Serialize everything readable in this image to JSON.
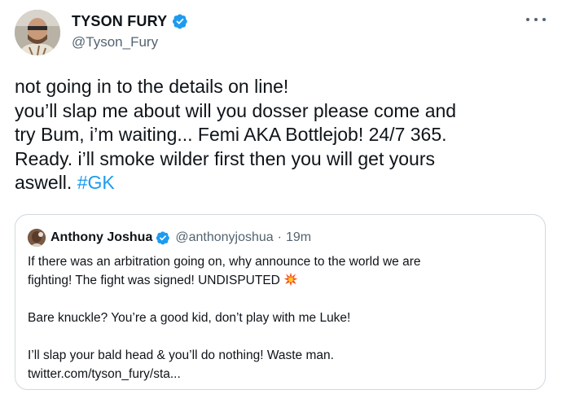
{
  "tweet": {
    "author": {
      "display_name": "TYSON FURY",
      "handle": "@Tyson_Fury",
      "verified_icon": "verified-badge-icon"
    },
    "more_icon": "more-options-icon",
    "text_lines": [
      "not going in to the details on line!",
      "you’ll slap me about will you dosser please come and",
      "try Bum, i’m waiting... Femi AKA Bottlejob! 24/7 365.",
      "Ready. i’ll smoke wilder first then you will get yours"
    ],
    "text_last_prefix": "aswell. ",
    "hashtag": "#GK"
  },
  "quote": {
    "display_name": "Anthony Joshua",
    "handle": "@anthonyjoshua",
    "separator": "·",
    "time": "19m",
    "line1": "If there was an arbitration going on, why announce to the world we are",
    "line2": "fighting! The fight was signed! UNDISPUTED",
    "line2_emoji": "collision-icon",
    "line3": "Bare knuckle? You’re a good kid, don’t play with me Luke!",
    "line4": "I’ll slap your bald head & you’ll do nothing! Waste man.",
    "link": "twitter.com/tyson_fury/sta..."
  },
  "colors": {
    "verified_blue": "#1d9bf0",
    "secondary_text": "#536471",
    "border": "#cfd9de"
  }
}
